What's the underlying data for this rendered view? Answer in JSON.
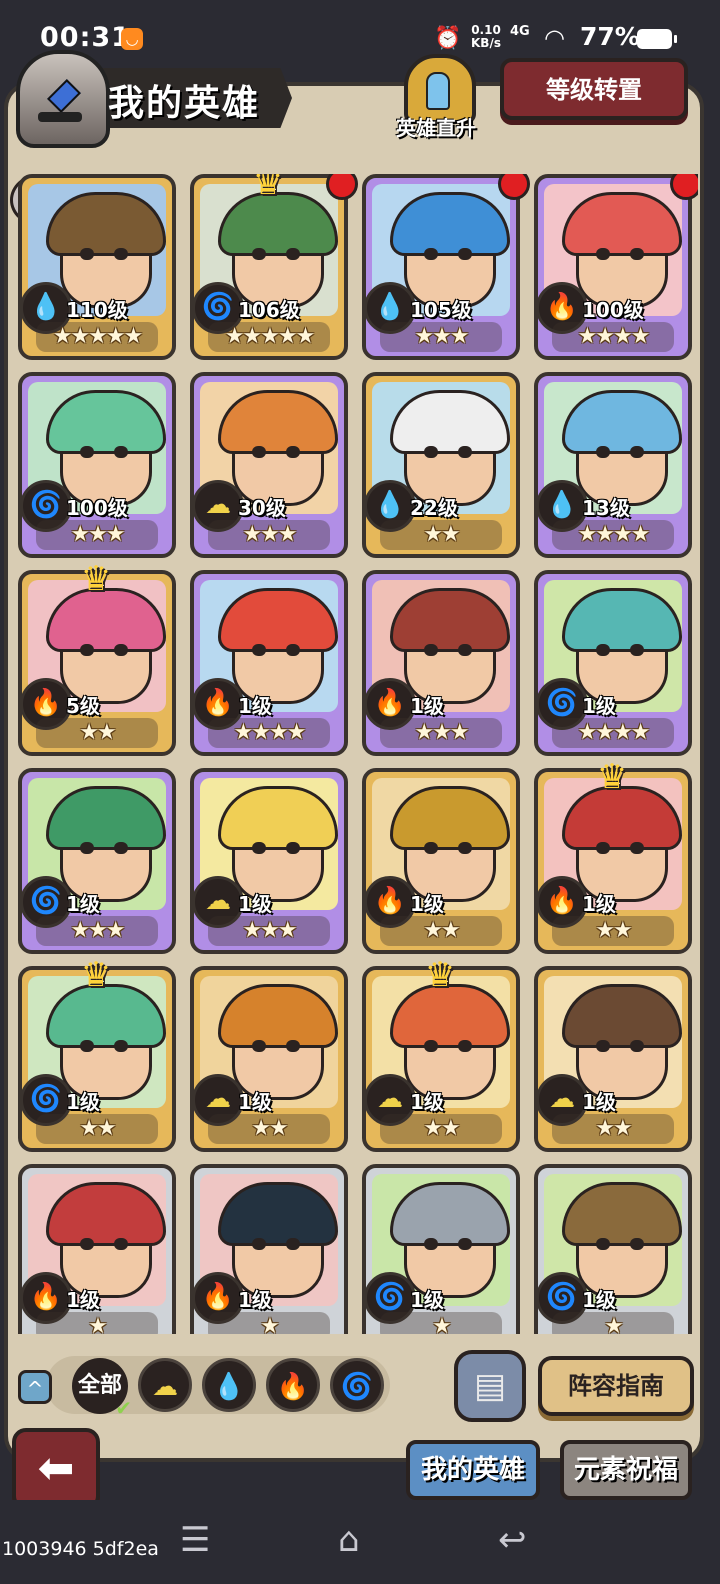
{
  "statusbar": {
    "time": "00:31",
    "speed_value": "0.10",
    "speed_unit": "KB/s",
    "network": "4G",
    "battery": "77%"
  },
  "header": {
    "title": "我的英雄",
    "upgrade_label": "英雄直升",
    "transfer_button": "等级转置"
  },
  "rank_badge": "1",
  "heroes": [
    {
      "level": "110级",
      "stars": "★★★★★",
      "element": "water",
      "element_icon": "💧",
      "rarity": "gold",
      "hair": "#7a5a33",
      "bg": "#a7c7e6",
      "crown": false,
      "new": false
    },
    {
      "level": "106级",
      "stars": "★★★★★",
      "element": "wind",
      "element_icon": "🌀",
      "rarity": "gold",
      "hair": "#4d8a4c",
      "bg": "#d9e0cf",
      "crown": true,
      "new": true
    },
    {
      "level": "105级",
      "stars": "★★★",
      "element": "water",
      "element_icon": "💧",
      "rarity": "purple",
      "hair": "#3f8fd6",
      "bg": "#b7d7f0",
      "crown": false,
      "new": true
    },
    {
      "level": "100级",
      "stars": "★★★★",
      "element": "fire",
      "element_icon": "🔥",
      "rarity": "purple",
      "hair": "#e25a54",
      "bg": "#f3c4c9",
      "crown": false,
      "new": true
    },
    {
      "level": "100级",
      "stars": "★★★",
      "element": "wind",
      "element_icon": "🌀",
      "rarity": "purple",
      "hair": "#66c59b",
      "bg": "#bfe3c9",
      "crown": false,
      "new": false
    },
    {
      "level": "30级",
      "stars": "★★★",
      "element": "earth",
      "element_icon": "☁",
      "rarity": "purple",
      "hair": "#e0843a",
      "bg": "#f2d3a7",
      "crown": false,
      "new": false
    },
    {
      "level": "22级",
      "stars": "★★",
      "element": "water",
      "element_icon": "💧",
      "rarity": "gold",
      "hair": "#eeeeee",
      "bg": "#b8dcea",
      "crown": false,
      "new": false
    },
    {
      "level": "13级",
      "stars": "★★★★",
      "element": "water",
      "element_icon": "💧",
      "rarity": "purple",
      "hair": "#6fb7e0",
      "bg": "#c8e7cc",
      "crown": false,
      "new": false
    },
    {
      "level": "5级",
      "stars": "★★",
      "element": "fire",
      "element_icon": "🔥",
      "rarity": "gold",
      "hair": "#e0628f",
      "bg": "#f1c1c4",
      "crown": true,
      "new": false
    },
    {
      "level": "1级",
      "stars": "★★★★",
      "element": "fire",
      "element_icon": "🔥",
      "rarity": "purple",
      "hair": "#e24b3b",
      "bg": "#b8d9f0",
      "crown": false,
      "new": false
    },
    {
      "level": "1级",
      "stars": "★★★",
      "element": "fire",
      "element_icon": "🔥",
      "rarity": "purple",
      "hair": "#9e3f34",
      "bg": "#f0c0b6",
      "crown": false,
      "new": false
    },
    {
      "level": "1级",
      "stars": "★★★★",
      "element": "wind",
      "element_icon": "🌀",
      "rarity": "purple",
      "hair": "#56b7b3",
      "bg": "#cfe6a8",
      "crown": false,
      "new": false
    },
    {
      "level": "1级",
      "stars": "★★★",
      "element": "wind",
      "element_icon": "🌀",
      "rarity": "purple",
      "hair": "#3f9a66",
      "bg": "#c8e6a8",
      "crown": false,
      "new": false
    },
    {
      "level": "1级",
      "stars": "★★★",
      "element": "earth",
      "element_icon": "☁",
      "rarity": "purple",
      "hair": "#f0cf55",
      "bg": "#f4e9a0",
      "crown": false,
      "new": false
    },
    {
      "level": "1级",
      "stars": "★★",
      "element": "fire",
      "element_icon": "🔥",
      "rarity": "gold",
      "hair": "#c99a2e",
      "bg": "#f0d8a4",
      "crown": false,
      "new": false
    },
    {
      "level": "1级",
      "stars": "★★",
      "element": "fire",
      "element_icon": "🔥",
      "rarity": "gold",
      "hair": "#c43b37",
      "bg": "#f3c2bf",
      "crown": true,
      "new": false
    },
    {
      "level": "1级",
      "stars": "★★",
      "element": "wind",
      "element_icon": "🌀",
      "rarity": "gold",
      "hair": "#58b98f",
      "bg": "#cfe7c0",
      "crown": true,
      "new": false
    },
    {
      "level": "1级",
      "stars": "★★",
      "element": "earth",
      "element_icon": "☁",
      "rarity": "gold",
      "hair": "#d6822c",
      "bg": "#f0d49c",
      "crown": false,
      "new": false
    },
    {
      "level": "1级",
      "stars": "★★",
      "element": "earth",
      "element_icon": "☁",
      "rarity": "gold",
      "hair": "#e0663b",
      "bg": "#f3e0a6",
      "crown": true,
      "new": false
    },
    {
      "level": "1级",
      "stars": "★★",
      "element": "earth",
      "element_icon": "☁",
      "rarity": "gold",
      "hair": "#6b4a33",
      "bg": "#f3dfb2",
      "crown": false,
      "new": false
    },
    {
      "level": "1级",
      "stars": "★",
      "element": "fire",
      "element_icon": "🔥",
      "rarity": "silver",
      "hair": "#c23d3d",
      "bg": "#f0c6c4",
      "crown": false,
      "new": false
    },
    {
      "level": "1级",
      "stars": "★",
      "element": "fire",
      "element_icon": "🔥",
      "rarity": "silver",
      "hair": "#233240",
      "bg": "#efc6c4",
      "crown": false,
      "new": false
    },
    {
      "level": "1级",
      "stars": "★",
      "element": "wind",
      "element_icon": "🌀",
      "rarity": "silver",
      "hair": "#9aa3ad",
      "bg": "#c9e6a8",
      "crown": false,
      "new": false
    },
    {
      "level": "1级",
      "stars": "★",
      "element": "wind",
      "element_icon": "🌀",
      "rarity": "silver",
      "hair": "#8a6a3c",
      "bg": "#cfe6a8",
      "crown": false,
      "new": false
    }
  ],
  "filters": {
    "all_label": "全部",
    "elements": [
      {
        "name": "earth",
        "icon": "☁",
        "color": "#f0d24a"
      },
      {
        "name": "water",
        "icon": "💧",
        "color": "#4fa6e8"
      },
      {
        "name": "fire",
        "icon": "🔥",
        "color": "#ef6b6b"
      },
      {
        "name": "wind",
        "icon": "🌀",
        "color": "#7cd04c"
      }
    ]
  },
  "bottom": {
    "guide_button": "阵容指南",
    "tab_active": "我的英雄",
    "tab_inactive": "元素祝福"
  },
  "build_info": "1003946 5df2ea"
}
